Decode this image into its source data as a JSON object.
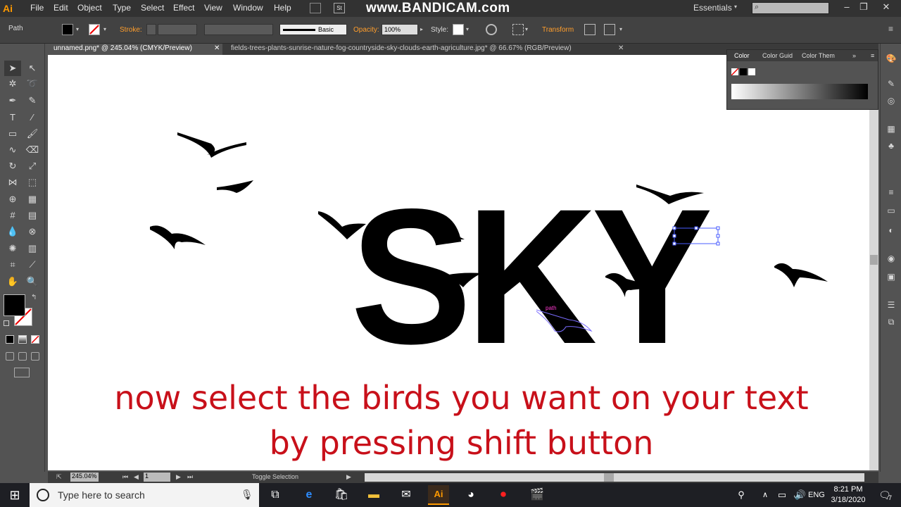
{
  "menubar": {
    "app_logo": "Ai",
    "items": [
      "File",
      "Edit",
      "Object",
      "Type",
      "Select",
      "Effect",
      "View",
      "Window",
      "Help"
    ],
    "watermark": "www.BANDICAM.com",
    "workspace": "Essentials"
  },
  "controlbar": {
    "selection_type": "Path",
    "stroke_label": "Stroke:",
    "brush_label": "Basic",
    "opacity_label": "Opacity:",
    "opacity_value": "100%",
    "style_label": "Style:",
    "transform_label": "Transform"
  },
  "tabs": [
    {
      "label": "unnamed.png* @ 245.04% (CMYK/Preview)"
    },
    {
      "label": "fields-trees-plants-sunrise-nature-fog-countryside-sky-clouds-earth-agriculture.jpg* @ 66.67% (RGB/Preview)"
    }
  ],
  "color_panel": {
    "tabs": [
      "Color",
      "Color Guid",
      "Color Them"
    ]
  },
  "canvas": {
    "word": "SKY",
    "path_hint": "path",
    "caption_line1": "now select the birds you want on your text",
    "caption_line2": "by pressing shift button"
  },
  "statusbar": {
    "zoom": "245.04%",
    "artboard": "1",
    "status": "Toggle Selection"
  },
  "taskbar": {
    "search_placeholder": "Type here to search",
    "language": "ENG",
    "time": "8:21 PM",
    "date": "3/18/2020",
    "notification_count": "7"
  },
  "colors": {
    "caption": "#c8101a",
    "app_accent": "#ff9a00",
    "canvas": "#ffffff"
  }
}
